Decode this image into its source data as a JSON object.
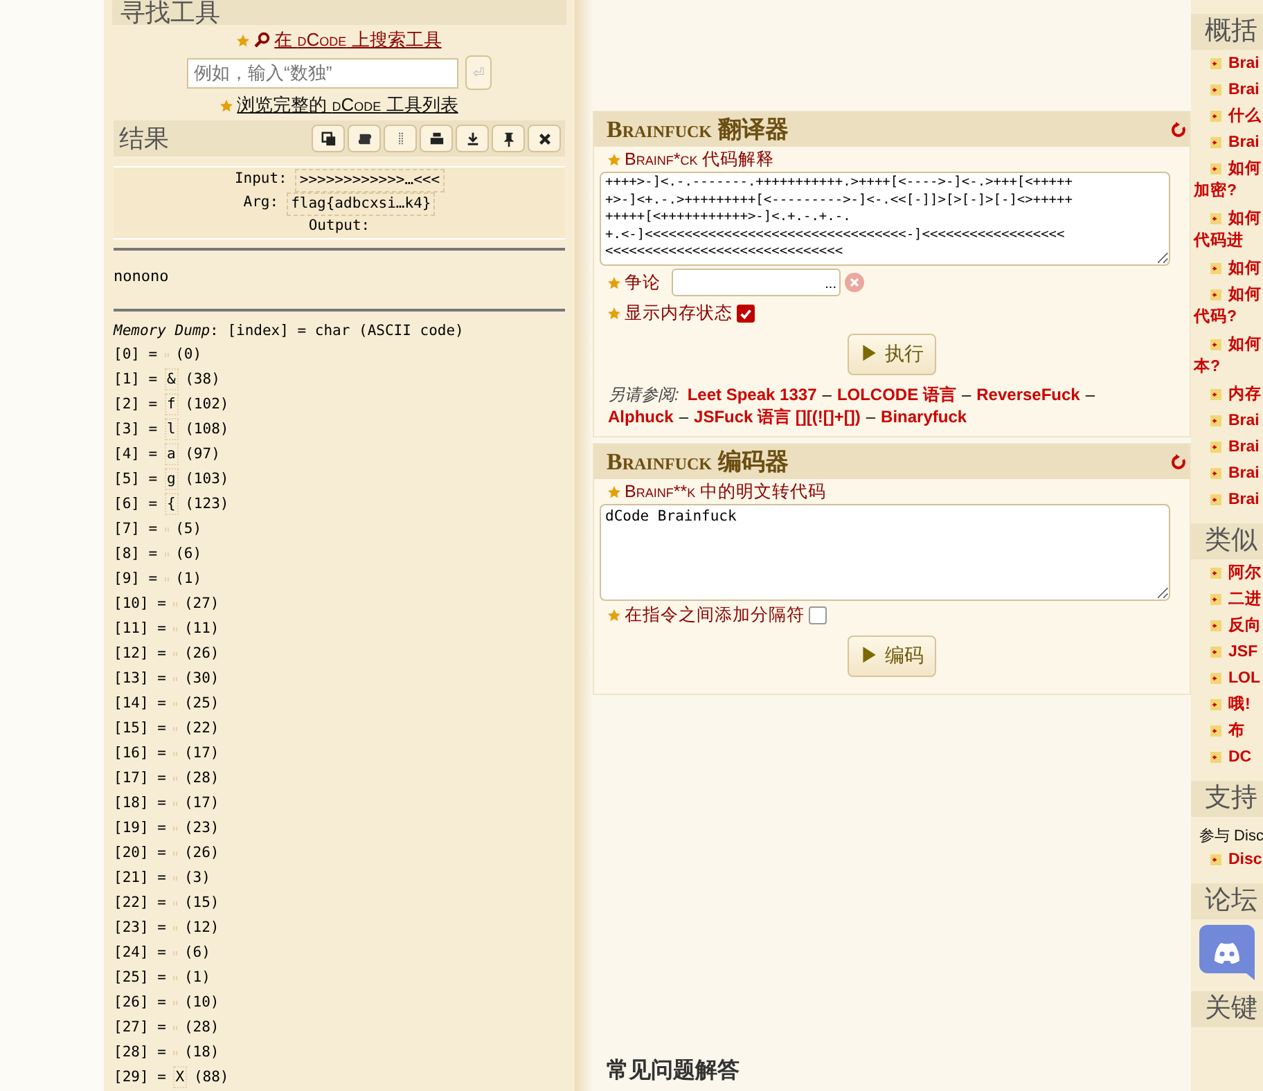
{
  "tools": {
    "heading": "寻找工具",
    "search_link": {
      "before": "在",
      "brand": "dCode",
      "after": "上搜索工具"
    },
    "search": {
      "placeholder": "例如，输入“数独”",
      "submit": "⏎"
    },
    "browse_link": {
      "before": "浏览完整的",
      "brand": "dCode",
      "after": "工具列表"
    }
  },
  "results": {
    "title": "结果",
    "toolbar": [
      {
        "kind": "copy"
      },
      {
        "kind": "scroll"
      },
      {
        "kind": "dots"
      },
      {
        "kind": "print"
      },
      {
        "kind": "download"
      },
      {
        "kind": "pin"
      },
      {
        "kind": "close"
      }
    ],
    "io": [
      {
        "label": "Input:",
        "value": ">>>>>>>>>>>>…<<<"
      },
      {
        "label": "Arg:",
        "value": "flag{adbcxsi…k4}"
      },
      {
        "label": "Output:"
      }
    ],
    "output": "nonono",
    "memory": {
      "legend_label": "Memory Dump",
      "legend": ": [index] = char (ASCII code)",
      "entries": [
        {
          "left": "[0] =",
          "code": "(0)"
        },
        {
          "left": "[1] =",
          "char": "&",
          "code": "(38)"
        },
        {
          "left": "[2] =",
          "char": "f",
          "code": "(102)"
        },
        {
          "left": "[3] =",
          "char": "l",
          "code": "(108)"
        },
        {
          "left": "[4] =",
          "char": "a",
          "code": "(97)"
        },
        {
          "left": "[5] =",
          "char": "g",
          "code": "(103)"
        },
        {
          "left": "[6] =",
          "char": "{",
          "code": "(123)"
        },
        {
          "left": "[7] =",
          "code": "(5)"
        },
        {
          "left": "[8] =",
          "code": "(6)"
        },
        {
          "left": "[9] =",
          "code": "(1)"
        },
        {
          "left": "[10] =",
          "code": "(27)"
        },
        {
          "left": "[11] =",
          "code": "(11)"
        },
        {
          "left": "[12] =",
          "code": "(26)"
        },
        {
          "left": "[13] =",
          "code": "(30)"
        },
        {
          "left": "[14] =",
          "code": "(25)"
        },
        {
          "left": "[15] =",
          "code": "(22)"
        },
        {
          "left": "[16] =",
          "code": "(17)"
        },
        {
          "left": "[17] =",
          "code": "(28)"
        },
        {
          "left": "[18] =",
          "code": "(17)"
        },
        {
          "left": "[19] =",
          "code": "(23)"
        },
        {
          "left": "[20] =",
          "code": "(26)"
        },
        {
          "left": "[21] =",
          "code": "(3)"
        },
        {
          "left": "[22] =",
          "code": "(15)"
        },
        {
          "left": "[23] =",
          "code": "(12)"
        },
        {
          "left": "[24] =",
          "code": "(6)"
        },
        {
          "left": "[25] =",
          "code": "(1)"
        },
        {
          "left": "[26] =",
          "code": "(10)"
        },
        {
          "left": "[27] =",
          "code": "(28)"
        },
        {
          "left": "[28] =",
          "code": "(18)"
        },
        {
          "left": "[29] =",
          "char": "X",
          "code": "(88)"
        }
      ]
    }
  },
  "translator": {
    "title": "Brainfuck 翻译器",
    "field_label": "Brainf*ck 代码解释",
    "code": "++++>-]<.-.-------.+++++++++++.>++++[<---->-]<-.>+++[<+++++\n+>-]<+.-.>+++++++++[<--------->-]<-.<<[-]]>[>[-]>[-]<>+++++\n+++++[<+++++++++++>-]<.+.-.+.-.\n+.<-]<<<<<<<<<<<<<<<<<<<<<<<<<<<<<<<<<-]<<<<<<<<<<<<<<<<<<\n<<<<<<<<<<<<<<<<<<<<<<<<<<<<<<",
    "arg_label": "争论",
    "arg_more": "...",
    "memory_label": "显示内存状态",
    "memory_checked": true,
    "button": {
      "icon": "▶",
      "label": "执行"
    },
    "see_also": {
      "label": "另请参阅:",
      "sep": "–",
      "links": [
        "Leet Speak 1337",
        "LOLCODE 语言",
        "ReverseFuck",
        "Alphuck",
        "JSFuck 语言 [][(![]+[])",
        "Binaryfuck"
      ]
    }
  },
  "encoder": {
    "title": "Brainfuck 编码器",
    "field_label": "Brainf**k 中的明文转代码",
    "text": "dCode Brainfuck",
    "separator_label": "在指令之间添加分隔符",
    "separator_checked": false,
    "button": {
      "icon": "▶",
      "label": "编码"
    }
  },
  "faq": "常见问题解答",
  "sidebar": [
    {
      "kind": "links",
      "title": "概括",
      "items": [
        {
          "text": "Brai"
        },
        {
          "text": "Brai"
        },
        {
          "text": "什么"
        },
        {
          "text": "Brai"
        },
        {
          "text": "如何",
          "cont": "加密?"
        },
        {
          "text": "如何",
          "cont": "代码进"
        },
        {
          "text": "如何"
        },
        {
          "text": "如何",
          "cont": "代码?"
        },
        {
          "text": "如何",
          "cont": "本?"
        },
        {
          "text": "内存"
        },
        {
          "text": "Brai"
        },
        {
          "text": "Brai"
        },
        {
          "text": "Brai"
        },
        {
          "text": "Brai"
        }
      ]
    },
    {
      "kind": "links",
      "title": "类似",
      "items": [
        {
          "text": "阿尔"
        },
        {
          "text": "二进"
        },
        {
          "text": "反向"
        },
        {
          "text": "JSF"
        },
        {
          "text": "LOL"
        },
        {
          "text": "哦!"
        },
        {
          "text": "布"
        },
        {
          "text": "DC"
        }
      ]
    },
    {
      "kind": "links",
      "title": "支持",
      "note": "参与 Disc",
      "items": [
        {
          "text": "Disc"
        }
      ]
    },
    {
      "kind": "forum",
      "title": "论坛"
    },
    {
      "kind": "heading",
      "title": "关键"
    }
  ]
}
